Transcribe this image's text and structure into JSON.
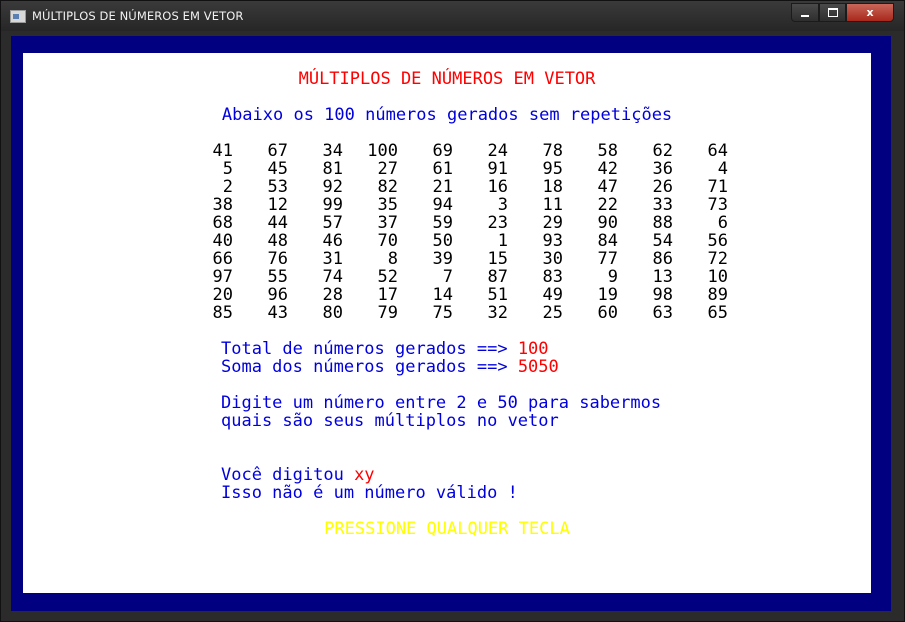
{
  "window": {
    "title": "MÚLTIPLOS DE NÚMEROS EM VETOR",
    "close_glyph": "x"
  },
  "console": {
    "header": "MÚLTIPLOS DE NÚMEROS EM VETOR",
    "subheader": "Abaixo os 100 números gerados sem repetições",
    "numbers": [
      [
        41,
        67,
        34,
        100,
        69,
        24,
        78,
        58,
        62,
        64
      ],
      [
        5,
        45,
        81,
        27,
        61,
        91,
        95,
        42,
        36,
        4
      ],
      [
        2,
        53,
        92,
        82,
        21,
        16,
        18,
        47,
        26,
        71
      ],
      [
        38,
        12,
        99,
        35,
        94,
        3,
        11,
        22,
        33,
        73
      ],
      [
        68,
        44,
        57,
        37,
        59,
        23,
        29,
        90,
        88,
        6
      ],
      [
        40,
        48,
        46,
        70,
        50,
        1,
        93,
        84,
        54,
        56
      ],
      [
        66,
        76,
        31,
        8,
        39,
        15,
        30,
        77,
        86,
        72
      ],
      [
        97,
        55,
        74,
        52,
        7,
        87,
        83,
        9,
        13,
        10
      ],
      [
        20,
        96,
        28,
        17,
        14,
        51,
        49,
        19,
        98,
        89
      ],
      [
        85,
        43,
        80,
        79,
        75,
        32,
        25,
        60,
        63,
        65
      ]
    ],
    "total_label": "Total de números gerados ==> ",
    "total_value": "100",
    "sum_label": "Soma dos números gerados ==> ",
    "sum_value": "5050",
    "prompt_line1": "Digite um número entre 2 e 50 para sabermos",
    "prompt_line2": "quais são seus múltiplos no vetor",
    "typed_label": "Você digitou ",
    "typed_value": "xy",
    "error_message": "Isso não é um número válido !",
    "press_key": "PRESSIONE QUALQUER TECLA"
  },
  "colors": {
    "console_border": "#000080",
    "screen_bg": "#ffffff",
    "header": "#ff0000",
    "info_text": "#0000dd",
    "press_key": "#ffff00"
  }
}
